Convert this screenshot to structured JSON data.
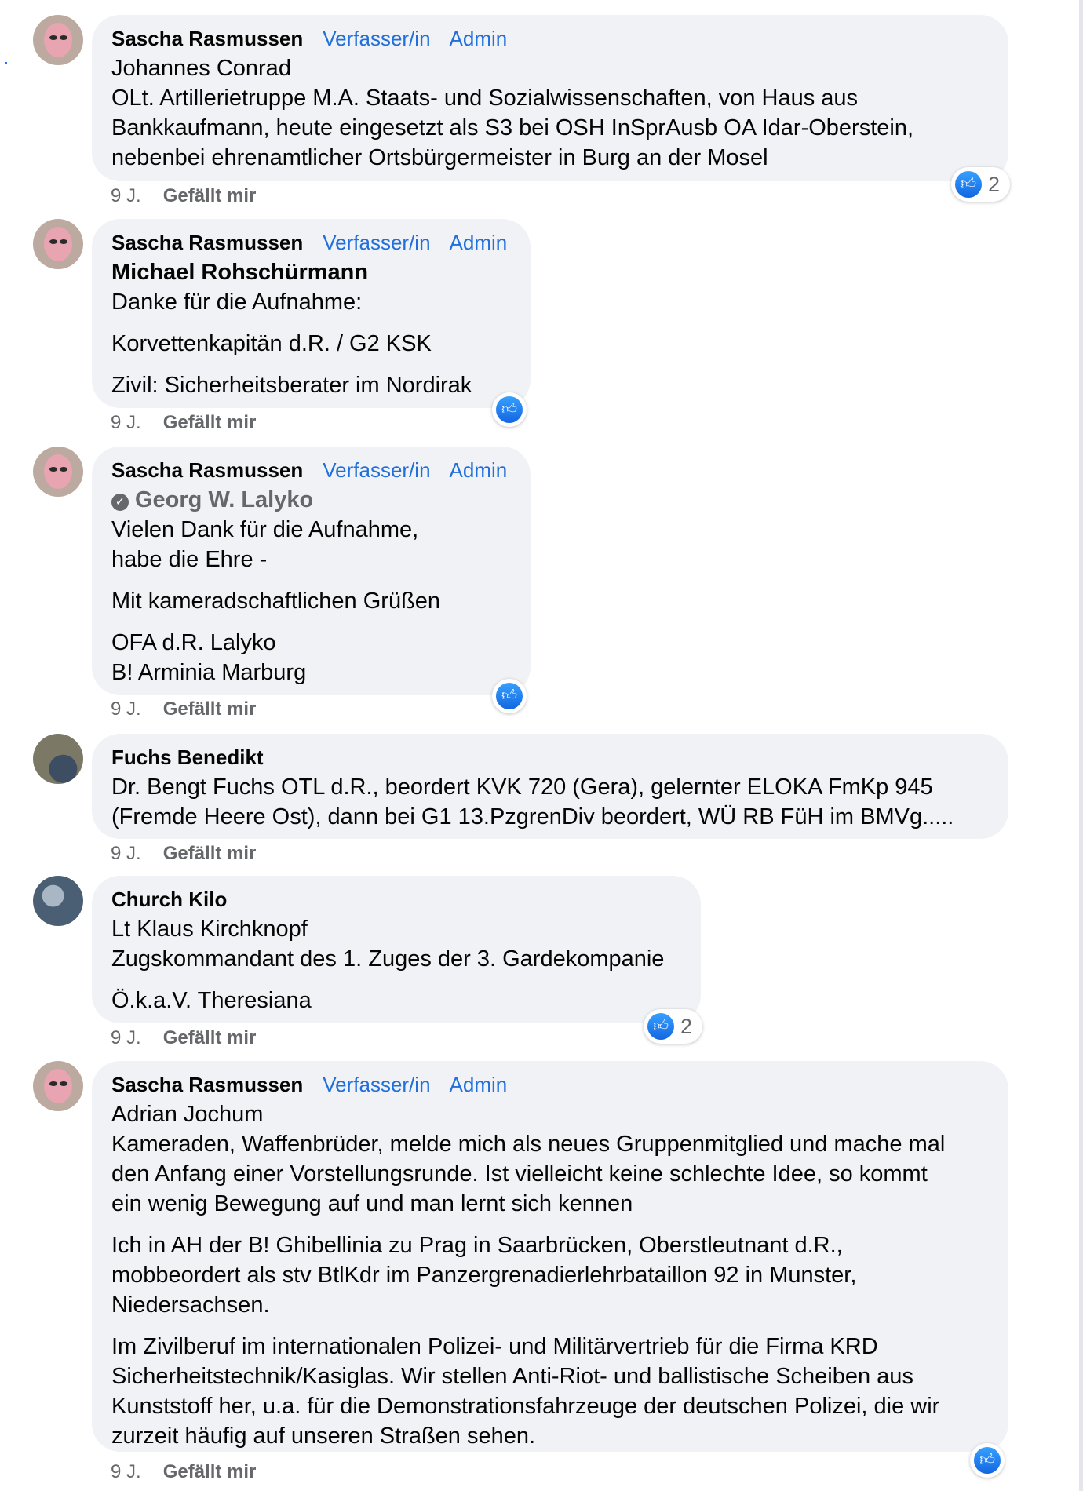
{
  "colors": {
    "badge": "#216fdb",
    "bubble": "#f0f2f5",
    "like_blue": "#1877f2",
    "meta": "#65676b"
  },
  "icons": {
    "like": "thumbs-up-icon",
    "verified": "verified-badge-icon"
  },
  "comments": [
    {
      "author": "Sascha Rasmussen",
      "badges": [
        "Verfasser/in",
        "Admin"
      ],
      "lines": [
        "Johannes Conrad",
        "OLt. Artillerietruppe M.A. Staats- und Sozialwissenschaften, von Haus aus",
        "Bankkaufmann, heute eingesetzt als S3 bei OSH InSprAusb OA Idar-Oberstein,",
        "nebenbei ehrenamtlicher Ortsbürgermeister in Burg an der Mosel"
      ],
      "time": "9 J.",
      "like_label": "Gefällt mir",
      "reaction_count": "2"
    },
    {
      "author": "Sascha Rasmussen",
      "badges": [
        "Verfasser/in",
        "Admin"
      ],
      "mention": "Michael Rohschürmann",
      "lines": [
        "Danke für die Aufnahme:",
        "Korvettenkapitän d.R. / G2 KSK",
        "Zivil: Sicherheitsberater im Nordirak"
      ],
      "time": "9 J.",
      "like_label": "Gefällt mir"
    },
    {
      "author": "Sascha Rasmussen",
      "badges": [
        "Verfasser/in",
        "Admin"
      ],
      "mention": "Georg W. Lalyko",
      "lines": [
        "Vielen Dank für die Aufnahme,",
        "habe die Ehre -",
        "Mit kameradschaftlichen Grüßen",
        "OFA d.R. Lalyko",
        "B! Arminia Marburg"
      ],
      "time": "9 J.",
      "like_label": "Gefällt mir"
    },
    {
      "author": "Fuchs Benedikt",
      "lines": [
        "Dr. Bengt Fuchs OTL d.R., beordert KVK 720 (Gera), gelernter ELOKA FmKp 945",
        "(Fremde Heere Ost), dann bei G1 13.PzgrenDiv beordert, WÜ RB FüH im BMVg....."
      ],
      "time": "9 J.",
      "like_label": "Gefällt mir"
    },
    {
      "author": "Church Kilo",
      "lines": [
        "Lt Klaus Kirchknopf",
        "Zugskommandant des 1. Zuges der 3. Gardekompanie",
        "Ö.k.a.V. Theresiana"
      ],
      "time": "9 J.",
      "like_label": "Gefällt mir",
      "reaction_count": "2"
    },
    {
      "author": "Sascha Rasmussen",
      "badges": [
        "Verfasser/in",
        "Admin"
      ],
      "lines": [
        "Adrian Jochum",
        "Kameraden, Waffenbrüder, melde mich als neues Gruppenmitglied und mache mal",
        "den Anfang einer Vorstellungsrunde. Ist vielleicht keine schlechte Idee, so kommt",
        "ein wenig Bewegung auf und man lernt sich kennen",
        "Ich in AH der B! Ghibellinia zu Prag in Saarbrücken, Oberstleutnant d.R.,",
        "mobbeordert als stv BtlKdr im Panzergrenadierlehrbataillon 92 in Munster,",
        "Niedersachsen.",
        "Im Zivilberuf im internationalen Polizei- und Militärvertrieb für die Firma KRD",
        "Sicherheitstechnik/Kasiglas. Wir stellen Anti-Riot- und ballistische Scheiben aus",
        "Kunststoff her, u.a. für die Demonstrationsfahrzeuge der deutschen Polizei, die wir",
        "zurzeit häufig auf unseren Straßen sehen."
      ],
      "time": "9 J.",
      "like_label": "Gefällt mir"
    }
  ]
}
